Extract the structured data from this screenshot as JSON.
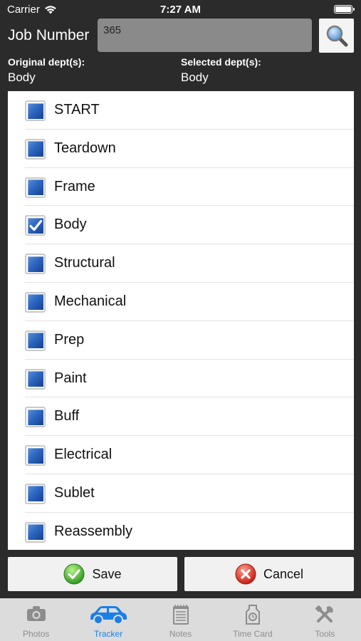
{
  "status_bar": {
    "carrier": "Carrier",
    "time": "7:27 AM"
  },
  "job": {
    "label": "Job Number",
    "value": "365",
    "search_icon": "magnifier-icon"
  },
  "departments": {
    "original_label": "Original dept(s):",
    "original_value": "Body",
    "selected_label": "Selected dept(s):",
    "selected_value": "Body"
  },
  "dept_list": [
    {
      "label": "START",
      "checked": false
    },
    {
      "label": "Teardown",
      "checked": false
    },
    {
      "label": "Frame",
      "checked": false
    },
    {
      "label": "Body",
      "checked": true
    },
    {
      "label": "Structural",
      "checked": false
    },
    {
      "label": "Mechanical",
      "checked": false
    },
    {
      "label": "Prep",
      "checked": false
    },
    {
      "label": "Paint",
      "checked": false
    },
    {
      "label": "Buff",
      "checked": false
    },
    {
      "label": "Electrical",
      "checked": false
    },
    {
      "label": "Sublet",
      "checked": false
    },
    {
      "label": "Reassembly",
      "checked": false
    }
  ],
  "actions": {
    "save_label": "Save",
    "cancel_label": "Cancel"
  },
  "tabs": [
    {
      "label": "Photos",
      "icon": "camera-icon",
      "active": false
    },
    {
      "label": "Tracker",
      "icon": "car-icon",
      "active": true
    },
    {
      "label": "Notes",
      "icon": "notepad-icon",
      "active": false
    },
    {
      "label": "Time Card",
      "icon": "time-card-icon",
      "active": false
    },
    {
      "label": "Tools",
      "icon": "tools-icon",
      "active": false
    }
  ],
  "colors": {
    "background": "#2b2b2b",
    "active_tab": "#1a7fe8",
    "checkbox_blue": "#2d66c0"
  }
}
